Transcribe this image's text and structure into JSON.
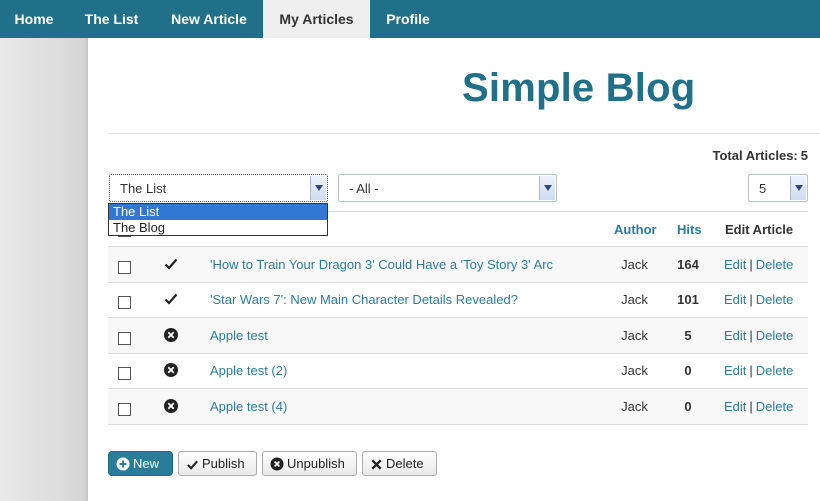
{
  "nav": {
    "items": [
      {
        "label": "Home"
      },
      {
        "label": "The List"
      },
      {
        "label": "New Article"
      },
      {
        "label": "My Articles"
      },
      {
        "label": "Profile"
      }
    ]
  },
  "page": {
    "title": "Simple Blog"
  },
  "summary": {
    "total_label": "Total Articles:",
    "total_value": "5"
  },
  "filters": {
    "category_value": "The List",
    "category_options": [
      "The List",
      "The Blog"
    ],
    "status_value": "- All -",
    "limit_value": "5"
  },
  "table": {
    "headers": {
      "author": "Author",
      "hits": "Hits",
      "edit": "Edit Article"
    },
    "rows": [
      {
        "title": "'How to Train Your Dragon 3' Could Have a 'Toy Story 3' Arc",
        "author": "Jack",
        "hits": "164",
        "status_icon": "check-icon",
        "edit": "Edit",
        "sep": "|",
        "delete": "Delete"
      },
      {
        "title": "'Star Wars 7': New Main Character Details Revealed?",
        "author": "Jack",
        "hits": "101",
        "status_icon": "check-icon",
        "edit": "Edit",
        "sep": "|",
        "delete": "Delete"
      },
      {
        "title": "Apple test",
        "author": "Jack",
        "hits": "5",
        "status_icon": "circle-x-icon",
        "edit": "Edit",
        "sep": "|",
        "delete": "Delete"
      },
      {
        "title": "Apple test (2)",
        "author": "Jack",
        "hits": "0",
        "status_icon": "circle-x-icon",
        "edit": "Edit",
        "sep": "|",
        "delete": "Delete"
      },
      {
        "title": "Apple test (4)",
        "author": "Jack",
        "hits": "0",
        "status_icon": "circle-x-icon",
        "edit": "Edit",
        "sep": "|",
        "delete": "Delete"
      }
    ]
  },
  "actions": {
    "new": "New",
    "publish": "Publish",
    "unpublish": "Unpublish",
    "delete": "Delete"
  },
  "colors": {
    "accent": "#21708a",
    "link": "#2a7ca0",
    "selection": "#3177d3"
  }
}
